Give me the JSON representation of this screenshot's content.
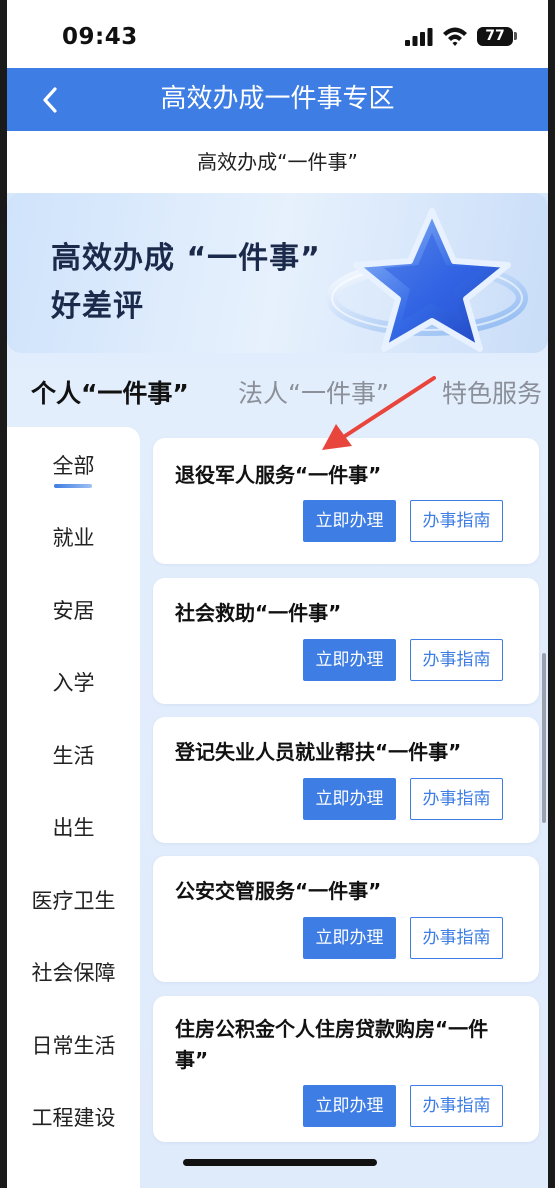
{
  "status_bar": {
    "time": "09:43",
    "battery": "77"
  },
  "nav": {
    "title": "高效办成一件事专区",
    "back_icon": "chevron-left-icon"
  },
  "subheader": "高效办成“一件事”",
  "banner": {
    "line1": "高效办成 “一件事”",
    "line2": "好差评"
  },
  "tabs": [
    {
      "label": "个人“一件事”",
      "active": true
    },
    {
      "label": "法人“一件事”",
      "active": false
    },
    {
      "label": "特色服务",
      "active": false
    }
  ],
  "sidebar": {
    "items": [
      "全部",
      "就业",
      "安居",
      "入学",
      "生活",
      "出生",
      "医疗卫生",
      "社会保障",
      "日常生活",
      "工程建设"
    ],
    "selected": "全部"
  },
  "cards": [
    {
      "title": "退役军人服务“一件事”",
      "primary": "立即办理",
      "secondary": "办事指南"
    },
    {
      "title": "社会救助“一件事”",
      "primary": "立即办理",
      "secondary": "办事指南"
    },
    {
      "title": "登记失业人员就业帮扶“一件事”",
      "primary": "立即办理",
      "secondary": "办事指南"
    },
    {
      "title": "公安交管服务“一件事”",
      "primary": "立即办理",
      "secondary": "办事指南"
    },
    {
      "title": "住房公积金个人住房贷款购房“一件事”",
      "primary": "立即办理",
      "secondary": "办事指南"
    }
  ],
  "colors": {
    "primary": "#3d7de4",
    "annotation_arrow": "#e8453c"
  }
}
